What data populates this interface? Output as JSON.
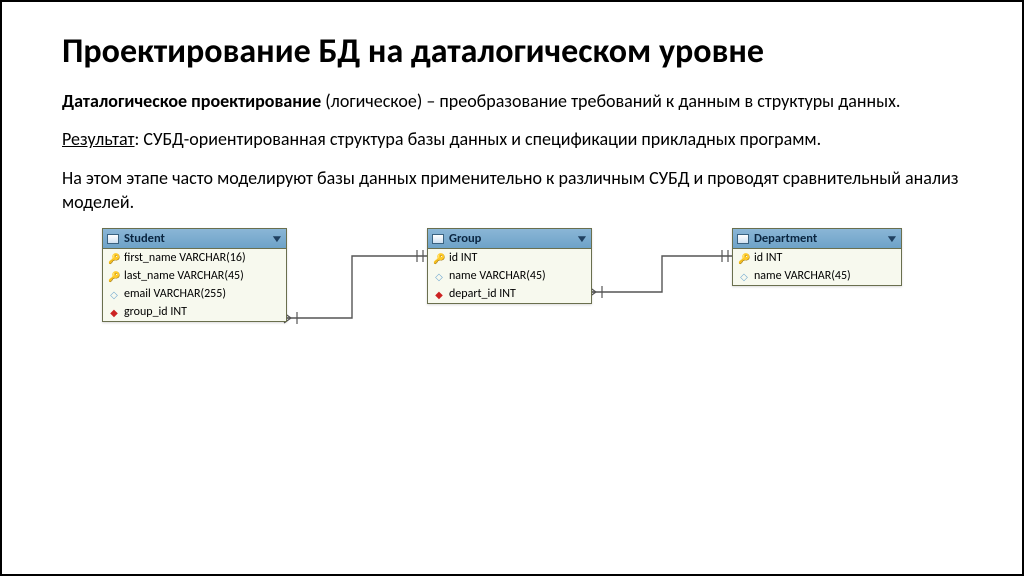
{
  "title": "Проектирование БД на даталогическом уровне",
  "para1_bold": "Даталогическое проектирование",
  "para1_rest": " (логическое) – преобразование требований к данным в структуры данных.",
  "para2_ul": "Результат",
  "para2_rest": ": СУБД-ориентированная структура базы данных и спецификации прикладных программ.",
  "para3": "На этом этапе часто моделируют базы данных применительно к различным СУБД и проводят сравнительный анализ моделей.",
  "tables": {
    "student": {
      "name": "Student",
      "cols": [
        {
          "mark": "key",
          "txt": "first_name VARCHAR(16)"
        },
        {
          "mark": "key",
          "txt": "last_name VARCHAR(45)"
        },
        {
          "mark": "circ",
          "txt": "email VARCHAR(255)"
        },
        {
          "mark": "fk",
          "txt": "group_id INT"
        }
      ]
    },
    "group": {
      "name": "Group",
      "cols": [
        {
          "mark": "key",
          "txt": "id INT"
        },
        {
          "mark": "circ",
          "txt": "name VARCHAR(45)"
        },
        {
          "mark": "fk",
          "txt": "depart_id INT"
        }
      ]
    },
    "department": {
      "name": "Department",
      "cols": [
        {
          "mark": "key",
          "txt": "id INT"
        },
        {
          "mark": "circ",
          "txt": "name VARCHAR(45)"
        }
      ]
    }
  }
}
